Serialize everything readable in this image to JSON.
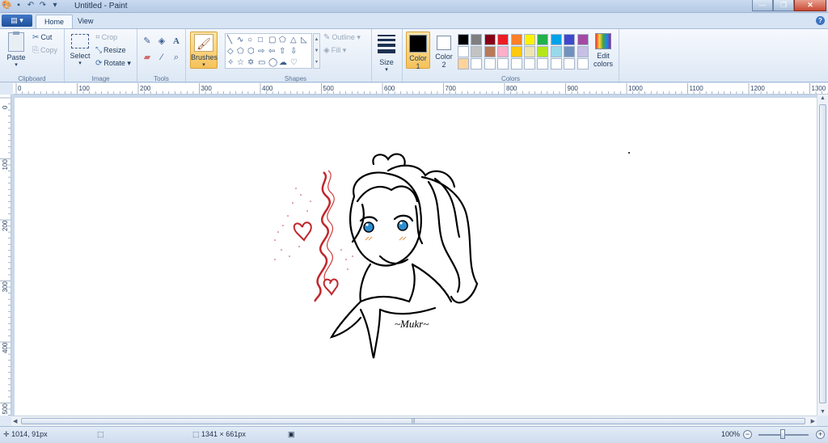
{
  "window": {
    "title": "Untitled - Paint"
  },
  "tabs": [
    {
      "label": "Home"
    },
    {
      "label": "View"
    }
  ],
  "clipboard": {
    "paste": "Paste",
    "cut": "Cut",
    "copy": "Copy",
    "group": "Clipboard"
  },
  "image": {
    "select": "Select",
    "crop": "Crop",
    "resize": "Resize",
    "rotate": "Rotate",
    "group": "Image"
  },
  "tools": {
    "group": "Tools"
  },
  "brushes": {
    "label": "Brushes"
  },
  "shapes": {
    "outline": "Outline",
    "fill": "Fill",
    "group": "Shapes"
  },
  "size": {
    "label": "Size"
  },
  "colors": {
    "color1": "Color 1",
    "color2": "Color 2",
    "color1_value": "#000000",
    "color2_value": "#ffffff",
    "edit": "Edit colors",
    "group": "Colors",
    "palette": [
      "#000000",
      "#7f7f7f",
      "#880015",
      "#ed1c24",
      "#ff7f27",
      "#fff200",
      "#22b14c",
      "#00a2e8",
      "#3f48cc",
      "#a349a4",
      "#ffffff",
      "#c3c3c3",
      "#b97a57",
      "#ffaec9",
      "#ffc90e",
      "#efe4b0",
      "#b5e61d",
      "#99d9ea",
      "#7092be",
      "#c8bfe7",
      "#ffd39b",
      "",
      "",
      "",
      "",
      "",
      "",
      "",
      "",
      ""
    ]
  },
  "ruler": {
    "h_ticks": [
      "0",
      "100",
      "200",
      "300",
      "400",
      "500",
      "600",
      "700",
      "800",
      "900",
      "1000",
      "1100",
      "1200",
      "1300"
    ],
    "v_ticks": [
      "0",
      "100",
      "200",
      "300",
      "400",
      "500"
    ]
  },
  "drawing": {
    "signature": "~Mukr~"
  },
  "status": {
    "cursor_pos": "1014, 91px",
    "image_size": "1341 × 661px",
    "zoom": "100%"
  }
}
